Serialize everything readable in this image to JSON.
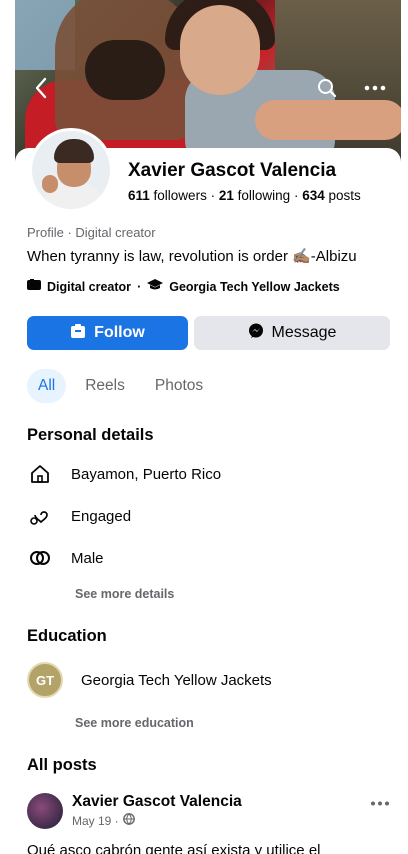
{
  "profile": {
    "name": "Xavier Gascot Valencia",
    "followers_count": "611",
    "followers_label": "followers",
    "following_count": "21",
    "following_label": "following",
    "posts_count": "634",
    "posts_label": "posts",
    "category": "Profile · Digital creator",
    "bio": "When tyranny is law, revolution is order ✍🏽-Albizu",
    "badge_creator": "Digital creator",
    "badge_school": "Georgia Tech Yellow Jackets"
  },
  "actions": {
    "follow_label": "Follow",
    "message_label": "Message"
  },
  "tabs": [
    {
      "label": "All",
      "active": true
    },
    {
      "label": "Reels",
      "active": false
    },
    {
      "label": "Photos",
      "active": false
    }
  ],
  "personal_details": {
    "title": "Personal details",
    "items": [
      {
        "icon": "home-icon",
        "label": "Bayamon, Puerto Rico"
      },
      {
        "icon": "hearts-icon",
        "label": "Engaged"
      },
      {
        "icon": "gender-icon",
        "label": "Male"
      }
    ],
    "see_more": "See more details"
  },
  "education": {
    "title": "Education",
    "school": "Georgia Tech Yellow Jackets",
    "see_more": "See more education"
  },
  "posts": {
    "title": "All posts",
    "author": "Xavier Gascot Valencia",
    "date": "May 19 ·",
    "text": "Qué asco cabrón gente así exista y utilice el"
  },
  "colors": {
    "accent": "#1b74e4",
    "secondary_button": "#e4e6eb",
    "muted_text": "#65676b"
  }
}
